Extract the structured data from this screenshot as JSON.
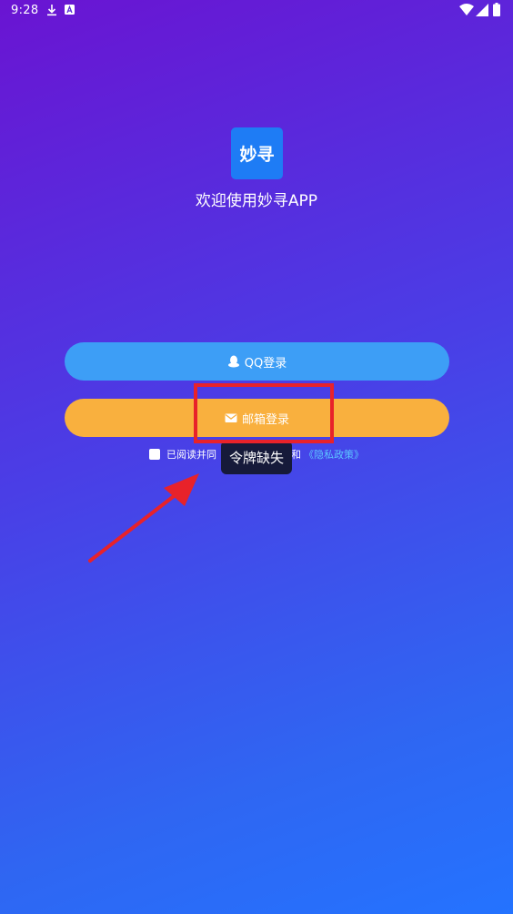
{
  "status_bar": {
    "time": "9:28",
    "download_icon": "download-icon",
    "a_icon": "a-icon",
    "wifi_icon": "wifi-icon",
    "signal_icon": "signal-icon",
    "battery_icon": "battery-icon"
  },
  "app": {
    "logo_text": "妙寻",
    "welcome": "欢迎使用妙寻APP"
  },
  "login": {
    "qq_label": "QQ登录",
    "email_label": "邮箱登录"
  },
  "agreement": {
    "prefix": "已阅读并同",
    "and": "和",
    "policy": "《隐私政策》"
  },
  "toast": {
    "message": "令牌缺失"
  },
  "colors": {
    "qq_button": "#3d9ef6",
    "email_button": "#f9b03e",
    "annotation": "#e8222a",
    "toast_bg": "#161a3a"
  }
}
